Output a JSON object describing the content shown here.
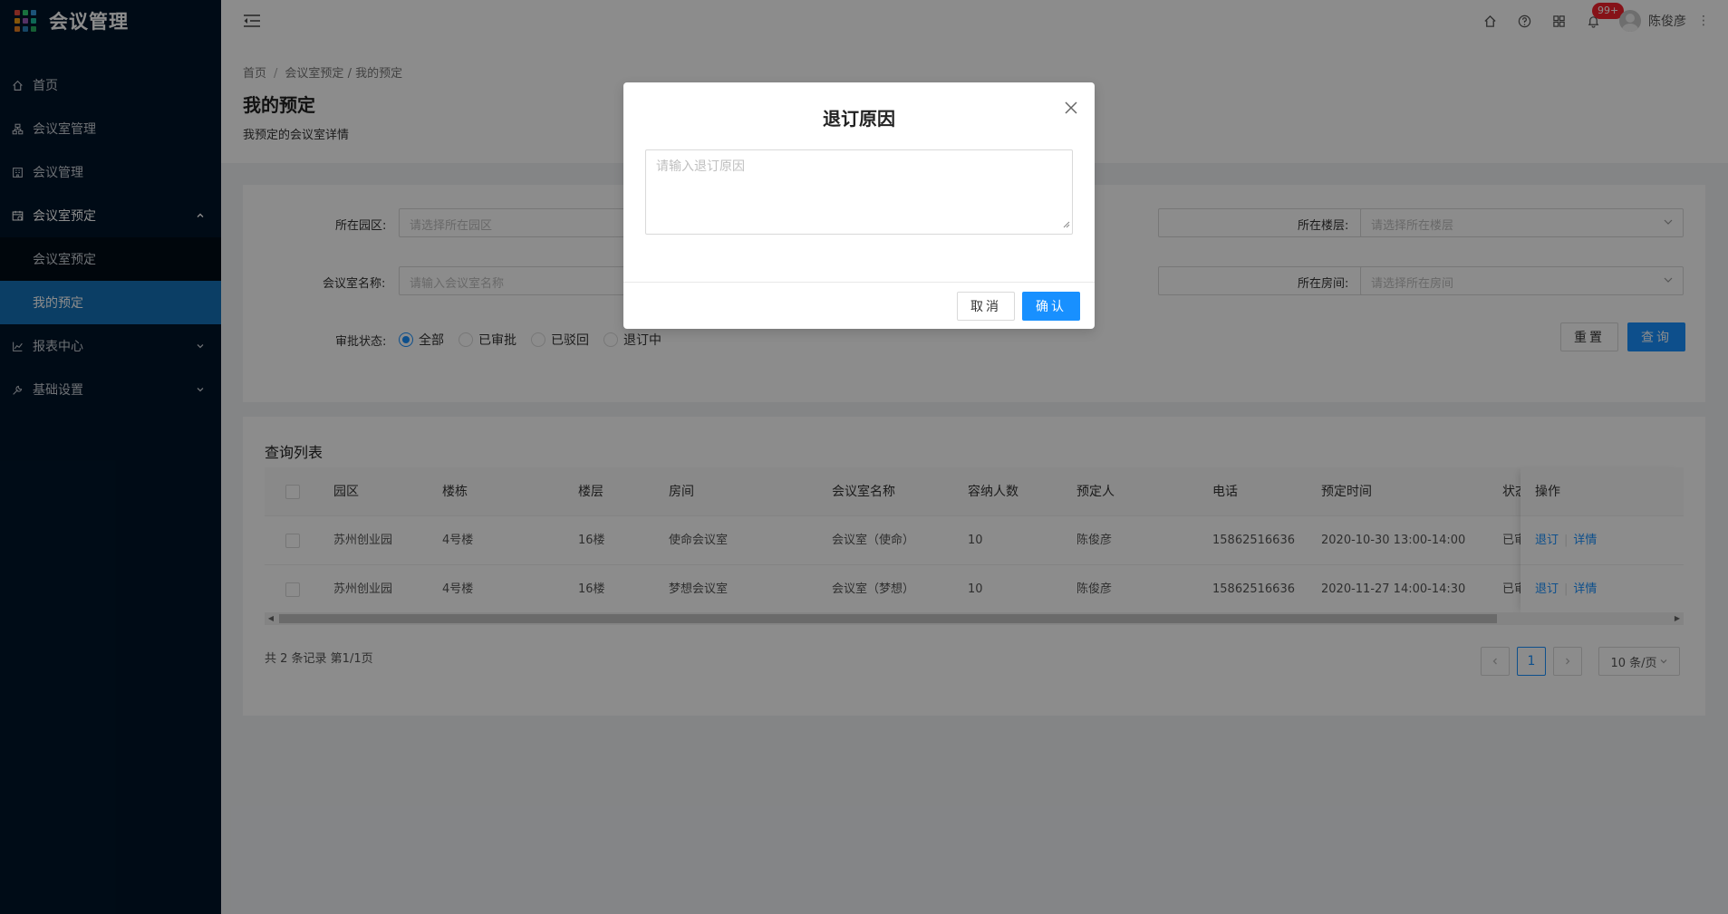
{
  "app": {
    "title": "会议管理",
    "logo_colors": [
      "#e84c3d",
      "#2ecc71",
      "#3498db",
      "#f39c12",
      "#9b59b6",
      "#1abc9c",
      "#e67e22",
      "#2980b9",
      "#27ae60"
    ]
  },
  "sidebar": {
    "items": [
      {
        "label": "首页",
        "icon": "home-icon"
      },
      {
        "label": "会议室管理",
        "icon": "cluster-icon"
      },
      {
        "label": "会议管理",
        "icon": "building-icon"
      },
      {
        "label": "会议室预定",
        "icon": "schedule-icon",
        "expanded": true,
        "children": [
          {
            "label": "会议室预定",
            "active": false
          },
          {
            "label": "我的预定",
            "active": true
          }
        ]
      },
      {
        "label": "报表中心",
        "icon": "line-chart-icon",
        "expanded": false
      },
      {
        "label": "基础设置",
        "icon": "tool-icon",
        "expanded": false
      }
    ]
  },
  "header": {
    "notifications_badge": "99+",
    "username": "陈俊彦"
  },
  "breadcrumb": {
    "home": "首页",
    "parent": "会议室预定",
    "sep2": "/",
    "current": "我的预定"
  },
  "page": {
    "title": "我的预定",
    "subtitle": "我预定的会议室详情"
  },
  "filters": {
    "park_label": "所在园区:",
    "park_placeholder": "请选择所在园区",
    "floor_label": "所在楼层:",
    "floor_placeholder": "请选择所在楼层",
    "room_name_label": "会议室名称:",
    "room_name_placeholder": "请输入会议室名称",
    "room_label": "所在房间:",
    "room_placeholder": "请选择所在房间",
    "status_label": "审批状态:",
    "status_options": [
      "全部",
      "已审批",
      "已驳回",
      "退订中"
    ],
    "status_selected": "全部",
    "reset_label": "重置",
    "query_label": "查询"
  },
  "table": {
    "title": "查询列表",
    "columns": [
      "园区",
      "楼栋",
      "楼层",
      "房间",
      "会议室名称",
      "容纳人数",
      "预定人",
      "电话",
      "预定时间",
      "状态",
      "操作"
    ],
    "rows": [
      [
        "苏州创业园",
        "4号楼",
        "16楼",
        "使命会议室",
        "会议室（使命）",
        "10",
        "陈俊彦",
        "15862516636",
        "2020-10-30 13:00-14:00",
        "已审"
      ],
      [
        "苏州创业园",
        "4号楼",
        "16楼",
        "梦想会议室",
        "会议室（梦想）",
        "10",
        "陈俊彦",
        "15862516636",
        "2020-11-27 14:00-14:30",
        "已审"
      ]
    ],
    "actions": {
      "cancel": "退订",
      "detail": "详情"
    },
    "total_text": "共 2 条记录 第1/1页",
    "current_page": "1",
    "page_size": "10 条/页"
  },
  "modal": {
    "title": "退订原因",
    "textarea_placeholder": "请输入退订原因",
    "cancel_label": "取消",
    "confirm_label": "确认"
  },
  "colors": {
    "primary": "#1890ff",
    "sidebar_bg": "#001529",
    "sidebar_active": "#1572b8",
    "badge": "#f5222d"
  }
}
